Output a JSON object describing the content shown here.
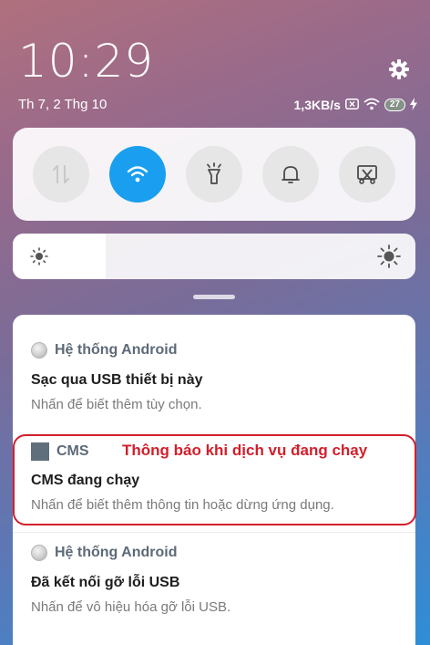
{
  "status_bar": {
    "time": "10:29",
    "date": "Th 7, 2 Thg 10",
    "network_speed": "1,3KB/s",
    "battery_level": "27",
    "battery_charging": true
  },
  "settings_icon": "gear-icon",
  "quick_toggles": [
    {
      "name": "mobile-data",
      "icon": "data-arrows-icon",
      "active": false
    },
    {
      "name": "wifi",
      "icon": "wifi-icon",
      "active": true
    },
    {
      "name": "flashlight",
      "icon": "flashlight-icon",
      "active": false
    },
    {
      "name": "sound",
      "icon": "bell-icon",
      "active": false
    },
    {
      "name": "screenshot",
      "icon": "scissors-screenshot-icon",
      "active": false
    }
  ],
  "brightness": {
    "level": 0.23,
    "low_icon": "sun-small-icon",
    "high_icon": "sun-large-icon"
  },
  "colors": {
    "accent": "#1a9ff0",
    "annotation": "#d21f2b",
    "app_name": "#5d6a78"
  },
  "notifications": [
    {
      "app": "Hệ thống Android",
      "app_icon": "android-system-icon",
      "title": "Sạc qua USB thiết bị này",
      "body": "Nhấn để biết thêm tùy chọn."
    },
    {
      "app": "CMS",
      "app_icon": "cms-app-icon",
      "title": "CMS đang chạy",
      "body": "Nhấn để biết thêm thông tin hoặc dừng ứng dụng.",
      "annotation": "Thông báo khi dịch vụ đang chạy"
    },
    {
      "app": "Hệ thống Android",
      "app_icon": "android-system-icon",
      "title": "Đã kết nối gỡ lỗi USB",
      "body": "Nhấn để vô hiệu hóa gỡ lỗi USB."
    }
  ]
}
